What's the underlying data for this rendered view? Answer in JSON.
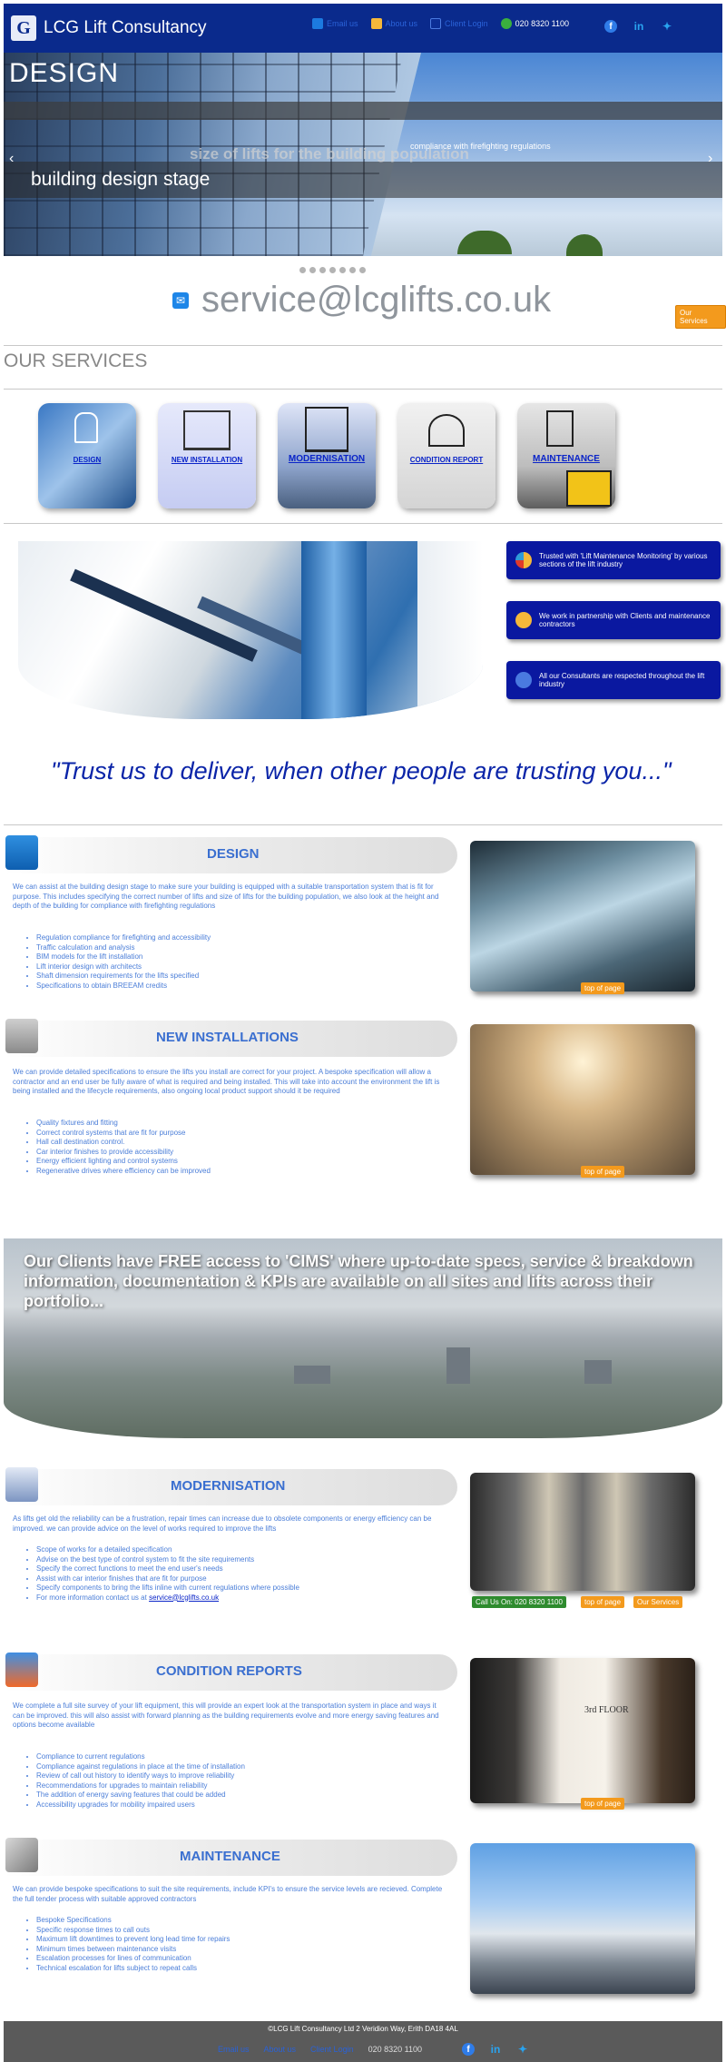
{
  "header": {
    "logo_letter": "G",
    "brand": "LCG Lift Consultancy",
    "nav": {
      "email": "Email us",
      "about": "About us",
      "client_login": "Client Login",
      "phone": "020 8320 1100"
    },
    "social": [
      "facebook-icon",
      "linkedin-icon",
      "twitter-icon"
    ]
  },
  "hero": {
    "title": "DESIGN",
    "subtitle": "building design stage",
    "ghost": "size of lifts for the building population",
    "small": "compliance with firefighting regulations",
    "prev": "‹",
    "next": "›",
    "slides": 7
  },
  "contact": {
    "email": "service@lcglifts.co.uk",
    "services_btn": "Our Services"
  },
  "services": {
    "heading": "OUR SERVICES",
    "cards": [
      "DESIGN",
      "NEW INSTALLATION",
      "MODERNISATION",
      "CONDITION REPORT",
      "MAINTENANCE"
    ]
  },
  "trust_cards": [
    "Trusted with 'Lift Maintenance Monitoring' by various sections of the lift industry",
    "We work in partnership with Clients and maintenance contractors",
    "All our Consultants are respected throughout the lift industry"
  ],
  "quote": "\"Trust us to deliver, when other people are trusting you...\"",
  "design": {
    "title": "DESIGN",
    "para": "We can assist at the building design stage to make sure your building is equipped with a suitable transportation system that is fit for purpose. This includes specifying the correct number of lifts and size of lifts for the building population, we also look at the height and depth of the building for compliance with firefighting regulations",
    "bullets": [
      "Regulation compliance for firefighting and accessibility",
      "Traffic calculation and analysis",
      "BIM models for the lift installation",
      "Lift interior design with architects",
      "Shaft dimension requirements for the lifts specified",
      "Specifications to obtain BREEAM credits"
    ],
    "top": "top of page"
  },
  "new_install": {
    "title": "NEW INSTALLATIONS",
    "para": "We can provide detailed specifications to ensure the lifts you install are correct for your project. A bespoke specification will allow a contractor and an end user be fully aware of what is required and being installed. This will take into account the environment the lift is being installed and the lifecycle requirements, also ongoing local product support should it be required",
    "bullets": [
      "Quality fixtures and fitting",
      "Correct control systems that are fit for purpose",
      "Hall call destination control.",
      "Car interior finishes to provide accessibility",
      "Energy efficient lighting and control systems",
      "Regenerative drives where efficiency can be improved"
    ],
    "top": "top of page"
  },
  "cims": {
    "text": "Our Clients have FREE access to 'CIMS' where up-to-date specs, service & breakdown information, documentation & KPIs are available on all sites and lifts across their portfolio..."
  },
  "modernisation": {
    "title": "MODERNISATION",
    "para": "As lifts get old the reliability can be a frustration, repair times can increase due to obsolete components or energy efficiency can be improved. we can provide advice on the level of works required to improve the lifts",
    "bullets": [
      "Scope of works for a detailed specification",
      "Advise on the best type of control system to fit the site requirements",
      "Specify the correct functions to meet the end user's needs",
      "Assist with car interior finishes that are fit for purpose",
      "Specify components to bring the lifts inline with current regulations where possible"
    ],
    "contact_prefix": "For more information contact us at",
    "contact_email": "service@lcglifts.co.uk",
    "call": "Call Us On: 020 8320 1100",
    "top": "top of page",
    "services": "Our Services"
  },
  "condition": {
    "title": "CONDITION REPORTS",
    "para": "We complete a full site survey of your lift equipment, this will provide an expert look at the transportation system in place and ways it can be improved. this will also assist with forward planning as the building requirements evolve and more energy saving features and options become available",
    "bullets": [
      "Compliance to current regulations",
      "Compliance against regulations in place at the time of installation",
      "Review of call out history to identify ways to improve reliability",
      "Recommendations for upgrades to maintain reliability",
      "The addition of energy saving features that could be added",
      "Accessibility upgrades for mobility impaired users"
    ],
    "sign": "3rd FLOOR",
    "top": "top of page"
  },
  "maintenance": {
    "title": "MAINTENANCE",
    "para": "We can provide bespoke specifications to suit the site requirements, include KPI's to ensure the service levels are recieved. Complete the full tender process with suitable approved contractors",
    "bullets": [
      "Bespoke Specifications",
      "Specific response times to call outs",
      "Maximum lift downtimes to prevent long lead time for repairs",
      "Minimum times between maintenance visits",
      "Escalation processes for lines of communication",
      "Technical escalation for lifts subject to repeat calls"
    ]
  },
  "footer": {
    "line": "©LCG Lift Consultancy Ltd 2 Veridion Way, Erith DA18 4AL",
    "email": "Email us",
    "about": "About us",
    "client_login": "Client Login",
    "phone": "020 8320 1100"
  }
}
